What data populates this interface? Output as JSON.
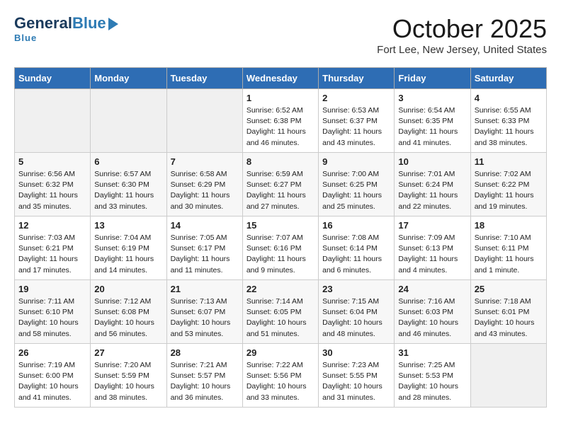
{
  "header": {
    "logo_general": "General",
    "logo_blue": "Blue",
    "month_title": "October 2025",
    "location": "Fort Lee, New Jersey, United States"
  },
  "days_of_week": [
    "Sunday",
    "Monday",
    "Tuesday",
    "Wednesday",
    "Thursday",
    "Friday",
    "Saturday"
  ],
  "weeks": [
    [
      null,
      null,
      null,
      {
        "day": 1,
        "sunrise": "6:52 AM",
        "sunset": "6:38 PM",
        "daylight": "11 hours and 46 minutes."
      },
      {
        "day": 2,
        "sunrise": "6:53 AM",
        "sunset": "6:37 PM",
        "daylight": "11 hours and 43 minutes."
      },
      {
        "day": 3,
        "sunrise": "6:54 AM",
        "sunset": "6:35 PM",
        "daylight": "11 hours and 41 minutes."
      },
      {
        "day": 4,
        "sunrise": "6:55 AM",
        "sunset": "6:33 PM",
        "daylight": "11 hours and 38 minutes."
      }
    ],
    [
      {
        "day": 5,
        "sunrise": "6:56 AM",
        "sunset": "6:32 PM",
        "daylight": "11 hours and 35 minutes."
      },
      {
        "day": 6,
        "sunrise": "6:57 AM",
        "sunset": "6:30 PM",
        "daylight": "11 hours and 33 minutes."
      },
      {
        "day": 7,
        "sunrise": "6:58 AM",
        "sunset": "6:29 PM",
        "daylight": "11 hours and 30 minutes."
      },
      {
        "day": 8,
        "sunrise": "6:59 AM",
        "sunset": "6:27 PM",
        "daylight": "11 hours and 27 minutes."
      },
      {
        "day": 9,
        "sunrise": "7:00 AM",
        "sunset": "6:25 PM",
        "daylight": "11 hours and 25 minutes."
      },
      {
        "day": 10,
        "sunrise": "7:01 AM",
        "sunset": "6:24 PM",
        "daylight": "11 hours and 22 minutes."
      },
      {
        "day": 11,
        "sunrise": "7:02 AM",
        "sunset": "6:22 PM",
        "daylight": "11 hours and 19 minutes."
      }
    ],
    [
      {
        "day": 12,
        "sunrise": "7:03 AM",
        "sunset": "6:21 PM",
        "daylight": "11 hours and 17 minutes."
      },
      {
        "day": 13,
        "sunrise": "7:04 AM",
        "sunset": "6:19 PM",
        "daylight": "11 hours and 14 minutes."
      },
      {
        "day": 14,
        "sunrise": "7:05 AM",
        "sunset": "6:17 PM",
        "daylight": "11 hours and 11 minutes."
      },
      {
        "day": 15,
        "sunrise": "7:07 AM",
        "sunset": "6:16 PM",
        "daylight": "11 hours and 9 minutes."
      },
      {
        "day": 16,
        "sunrise": "7:08 AM",
        "sunset": "6:14 PM",
        "daylight": "11 hours and 6 minutes."
      },
      {
        "day": 17,
        "sunrise": "7:09 AM",
        "sunset": "6:13 PM",
        "daylight": "11 hours and 4 minutes."
      },
      {
        "day": 18,
        "sunrise": "7:10 AM",
        "sunset": "6:11 PM",
        "daylight": "11 hours and 1 minute."
      }
    ],
    [
      {
        "day": 19,
        "sunrise": "7:11 AM",
        "sunset": "6:10 PM",
        "daylight": "10 hours and 58 minutes."
      },
      {
        "day": 20,
        "sunrise": "7:12 AM",
        "sunset": "6:08 PM",
        "daylight": "10 hours and 56 minutes."
      },
      {
        "day": 21,
        "sunrise": "7:13 AM",
        "sunset": "6:07 PM",
        "daylight": "10 hours and 53 minutes."
      },
      {
        "day": 22,
        "sunrise": "7:14 AM",
        "sunset": "6:05 PM",
        "daylight": "10 hours and 51 minutes."
      },
      {
        "day": 23,
        "sunrise": "7:15 AM",
        "sunset": "6:04 PM",
        "daylight": "10 hours and 48 minutes."
      },
      {
        "day": 24,
        "sunrise": "7:16 AM",
        "sunset": "6:03 PM",
        "daylight": "10 hours and 46 minutes."
      },
      {
        "day": 25,
        "sunrise": "7:18 AM",
        "sunset": "6:01 PM",
        "daylight": "10 hours and 43 minutes."
      }
    ],
    [
      {
        "day": 26,
        "sunrise": "7:19 AM",
        "sunset": "6:00 PM",
        "daylight": "10 hours and 41 minutes."
      },
      {
        "day": 27,
        "sunrise": "7:20 AM",
        "sunset": "5:59 PM",
        "daylight": "10 hours and 38 minutes."
      },
      {
        "day": 28,
        "sunrise": "7:21 AM",
        "sunset": "5:57 PM",
        "daylight": "10 hours and 36 minutes."
      },
      {
        "day": 29,
        "sunrise": "7:22 AM",
        "sunset": "5:56 PM",
        "daylight": "10 hours and 33 minutes."
      },
      {
        "day": 30,
        "sunrise": "7:23 AM",
        "sunset": "5:55 PM",
        "daylight": "10 hours and 31 minutes."
      },
      {
        "day": 31,
        "sunrise": "7:25 AM",
        "sunset": "5:53 PM",
        "daylight": "10 hours and 28 minutes."
      },
      null
    ]
  ]
}
